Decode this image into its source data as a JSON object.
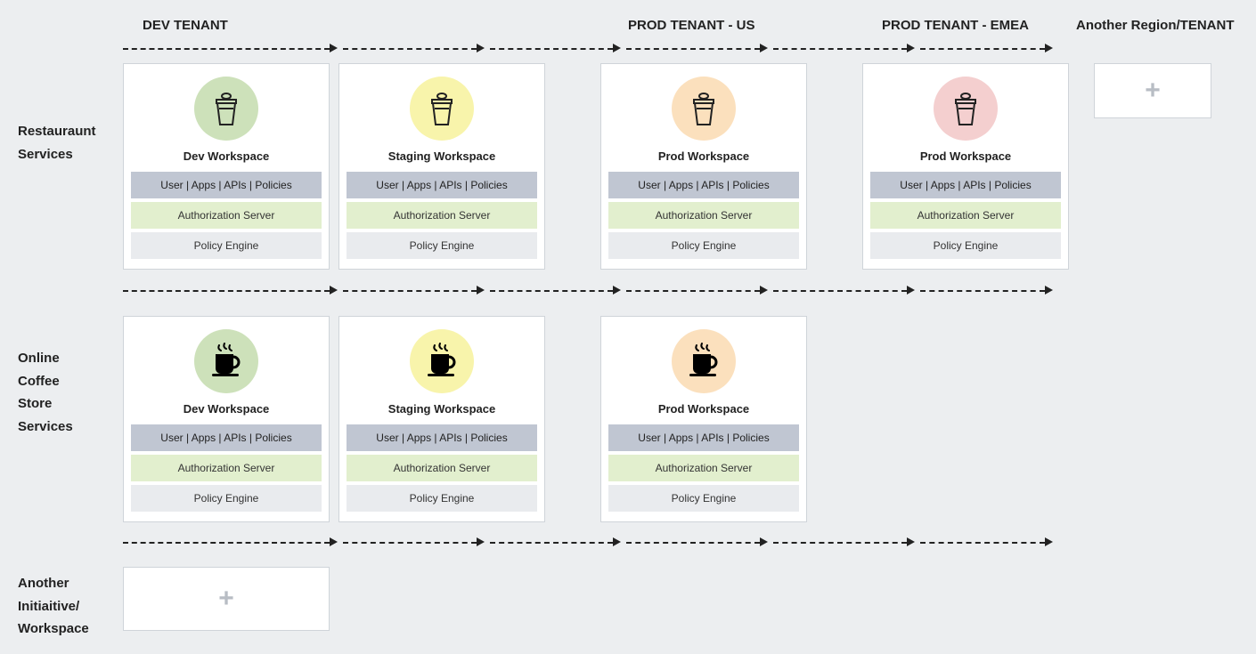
{
  "headers": {
    "dev": "DEV TENANT",
    "prodUs": "PROD TENANT - US",
    "prodEmea": "PROD TENANT - EMEA",
    "another": "Another Region/TENANT"
  },
  "rowLabels": {
    "restaurant": "Restauraunt\nServices",
    "coffee": "Online\nCoffee\nStore\nServices",
    "another": "Another\nInitiaitive/\nWorkspace"
  },
  "card": {
    "dev": "Dev Workspace",
    "staging": "Staging Workspace",
    "prod": "Prod Workspace",
    "tags": "User | Apps | APIs | Policies",
    "auth": "Authorization Server",
    "policy": "Policy Engine"
  },
  "plus": "+"
}
